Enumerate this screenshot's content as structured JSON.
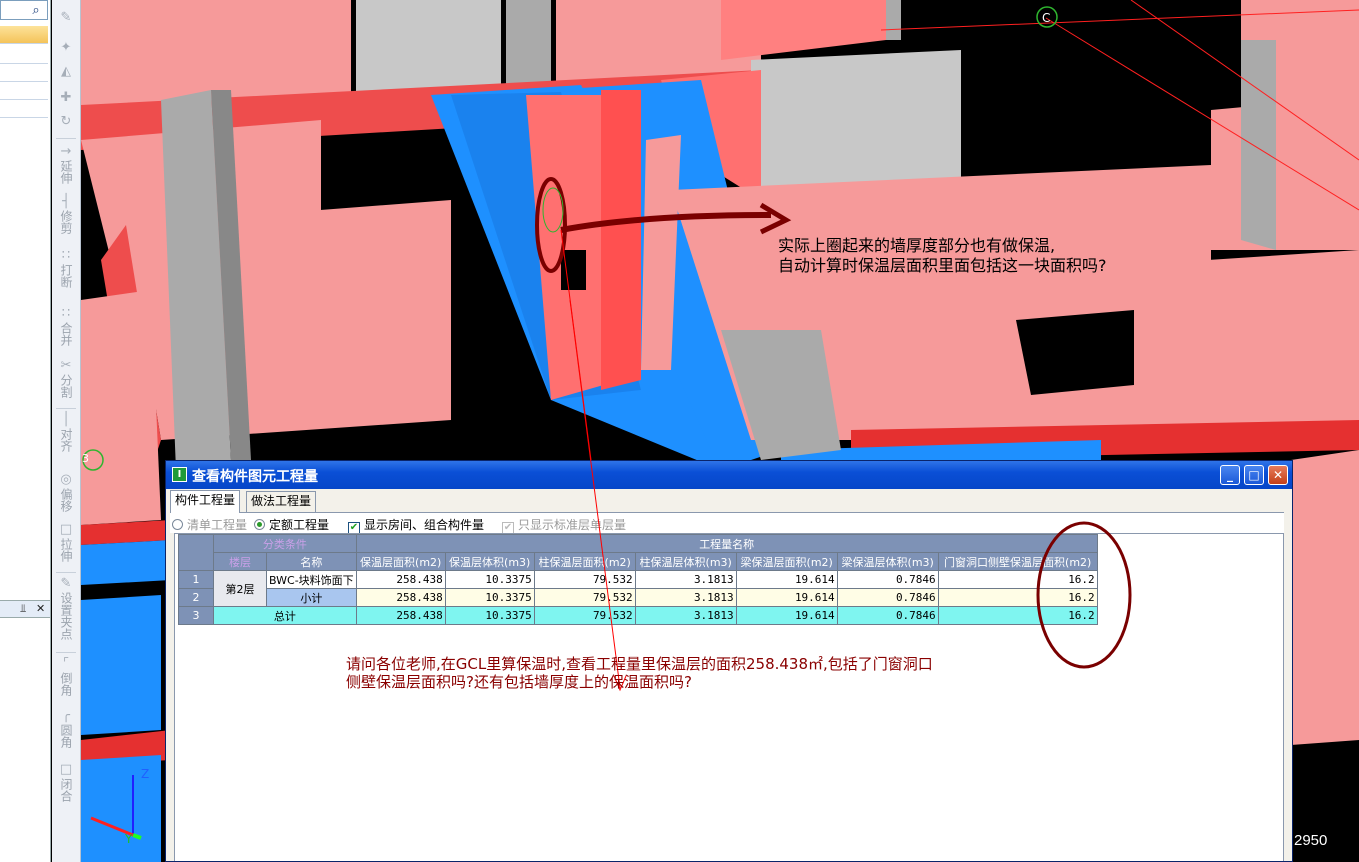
{
  "left_panel": {
    "search_icon": "search-icon"
  },
  "vtoolbar": {
    "items": [
      {
        "icon": "brush-icon",
        "label": ""
      },
      {
        "icon": "copy-icon",
        "label": ""
      },
      {
        "icon": "mirror-icon",
        "label": ""
      },
      {
        "icon": "move-icon",
        "label": ""
      },
      {
        "icon": "rotate-icon",
        "label": ""
      },
      {
        "icon": "extend-icon",
        "label": "延伸"
      },
      {
        "icon": "trim-icon",
        "label": "修剪"
      },
      {
        "icon": "break-icon",
        "label": "打断"
      },
      {
        "icon": "merge-icon",
        "label": "合并"
      },
      {
        "icon": "split-icon",
        "label": "分割"
      },
      {
        "icon": "align-icon",
        "label": "对齐"
      },
      {
        "icon": "offset-icon",
        "label": "偏移"
      },
      {
        "icon": "stretch-icon",
        "label": "拉伸"
      },
      {
        "icon": "setpoint-icon",
        "label": "设置夹点"
      },
      {
        "icon": "chamfer-icon",
        "label": "倒角"
      },
      {
        "icon": "fillet-icon",
        "label": "圆角"
      },
      {
        "icon": "close-shape-icon",
        "label": "闭合"
      }
    ]
  },
  "viewport": {
    "axis_marker": "C",
    "side_label": "3",
    "annotation1_line1": "实际上圈起来的墙厚度部分也有做保温,",
    "annotation1_line2": "自动计算时保温层面积里面包括这一块面积吗?",
    "annotation2_line1": "请问各位老师,在GCL里算保温时,查看工程量里保温层的面积258.438㎡,包括了门窗洞口",
    "annotation2_line2": "侧壁保温层面积吗?还有包括墙厚度上的保温面积吗?",
    "axis_z": "Z",
    "axis_y": "Y",
    "bottom_number": "2950"
  },
  "dialog": {
    "title": "查看构件图元工程量",
    "tabs": [
      "构件工程量",
      "做法工程量"
    ],
    "options": {
      "list_qty": "清单工程量",
      "quota_qty": "定额工程量",
      "show_rooms": "显示房间、组合构件量",
      "std_floor_only": "只显示标准层单层量"
    },
    "grid": {
      "group_category": "分类条件",
      "group_qty": "工程量名称",
      "columns": [
        "楼层",
        "名称",
        "保温层面积(m2)",
        "保温层体积(m3)",
        "柱保温层面积(m2)",
        "柱保温层体积(m3)",
        "梁保温层面积(m2)",
        "梁保温层体积(m3)",
        "门窗洞口侧壁保温层面积(m2)"
      ],
      "floor": "第2层",
      "rows": [
        {
          "no": "1",
          "name": "BWC-块料饰面下",
          "values": [
            "258.438",
            "10.3375",
            "79.532",
            "3.1813",
            "19.614",
            "0.7846",
            "16.2"
          ]
        },
        {
          "no": "2",
          "name": "小计",
          "values": [
            "258.438",
            "10.3375",
            "79.532",
            "3.1813",
            "19.614",
            "0.7846",
            "16.2"
          ]
        },
        {
          "no": "3",
          "name": "总计",
          "values": [
            "258.438",
            "10.3375",
            "79.532",
            "3.1813",
            "19.614",
            "0.7846",
            "16.2"
          ]
        }
      ]
    }
  }
}
